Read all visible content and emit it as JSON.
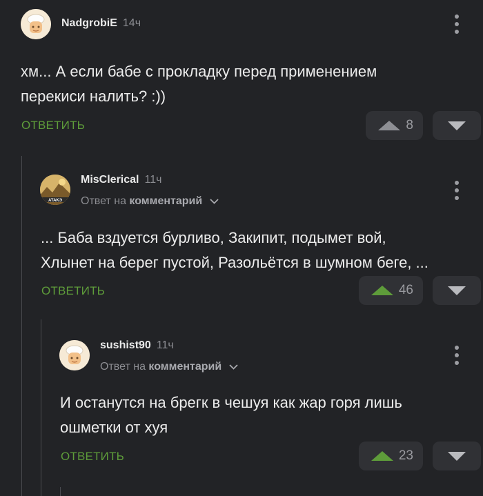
{
  "comments": [
    {
      "author": "NadgrobiE",
      "time": "14ч",
      "text_lines": [
        "хм... А если бабе с прокладку перед применением",
        "перекиси налить? :))"
      ],
      "reply_label": "ОТВЕТИТЬ",
      "votes": "8",
      "upvote_color": "#8e8f94"
    },
    {
      "author": "MisClerical",
      "time": "11ч",
      "reply_to_prefix": "Ответ на",
      "reply_to_target": "комментарий",
      "text_lines": [
        "... Баба вздуется бурливо, Закипит, подымет вой,",
        "Хлынет на берег пустой, Разольётся в шумном беге, ..."
      ],
      "reply_label": "ОТВЕТИТЬ",
      "votes": "46",
      "upvote_color": "#5e9c3a"
    },
    {
      "author": "sushist90",
      "time": "11ч",
      "reply_to_prefix": "Ответ на",
      "reply_to_target": "комментарий",
      "text_lines": [
        "И останутся на брегк в чешуя как жар горя лишь",
        "ошметки от хуя"
      ],
      "reply_label": "ОТВЕТИТЬ",
      "votes": "23",
      "upvote_color": "#5e9c3a"
    }
  ],
  "theme": {
    "background": "#222326",
    "accent_green": "#5e9c3a",
    "button_bg": "#303135"
  },
  "icons": [
    "kebab-menu-icon",
    "chevron-down-icon",
    "upvote-icon",
    "downvote-icon"
  ]
}
